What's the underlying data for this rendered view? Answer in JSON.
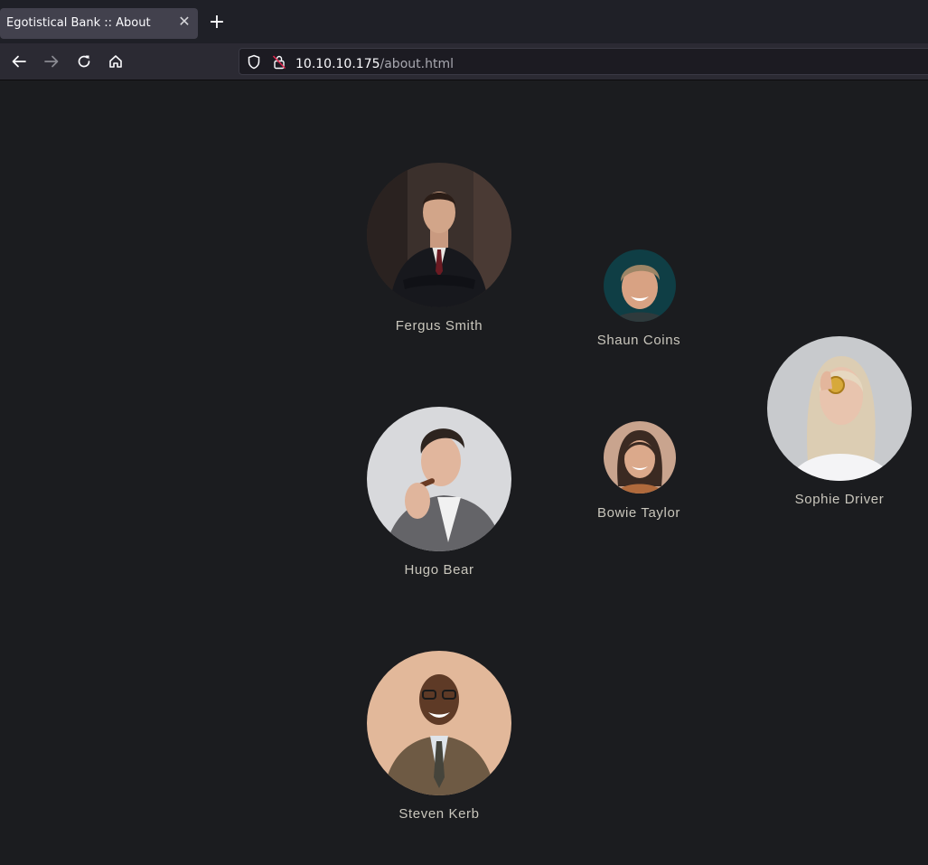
{
  "browser": {
    "tab_title": "Egotistical Bank :: About",
    "url_host": "10.10.10.175",
    "url_path": "/about.html"
  },
  "team": [
    {
      "name": "Fergus Smith",
      "icon": "portrait-man-suit"
    },
    {
      "name": "Shaun Coins",
      "icon": "portrait-smiling-man"
    },
    {
      "name": "Sophie Driver",
      "icon": "portrait-woman-coin"
    },
    {
      "name": "Hugo Bear",
      "icon": "portrait-man-cigar"
    },
    {
      "name": "Bowie Taylor",
      "icon": "portrait-smiling-woman"
    },
    {
      "name": "Steven Kerb",
      "icon": "portrait-man-glasses"
    }
  ],
  "colors": {
    "page_background": "#1b1c1f",
    "name_text": "#c9c6bc"
  }
}
